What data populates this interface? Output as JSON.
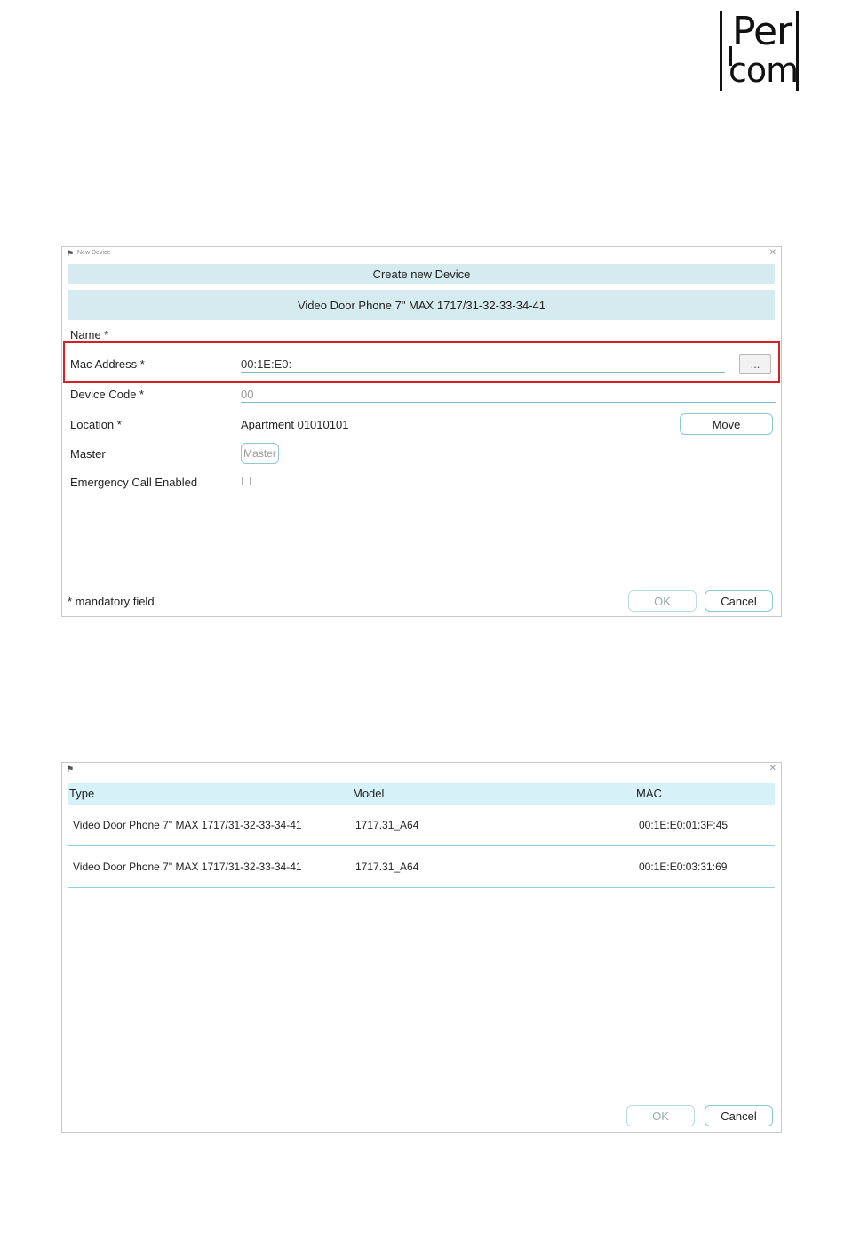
{
  "logo": {
    "line1": "Per",
    "line2": "com"
  },
  "dialog1": {
    "window_title": "New Device",
    "header": "Create new Device",
    "device_type": "Video Door Phone 7\" MAX 1717/31-32-33-34-41",
    "fields": {
      "name_label": "Name *",
      "mac_label": "Mac Address *",
      "mac_value": "00:1E:E0:",
      "mac_browse": "...",
      "code_label": "Device Code *",
      "code_value": "00",
      "location_label": "Location *",
      "location_value": "Apartment 01010101",
      "move_button": "Move",
      "master_label": "Master",
      "master_button": "Master",
      "emergency_label": "Emergency Call Enabled"
    },
    "footer_note": "* mandatory field",
    "ok": "OK",
    "cancel": "Cancel"
  },
  "dialog2": {
    "columns": [
      "Type",
      "Model",
      "MAC"
    ],
    "rows": [
      {
        "type": "Video Door Phone 7\" MAX 1717/31-32-33-34-41",
        "model": "1717.31_A64",
        "mac": "00:1E:E0:01:3F:45"
      },
      {
        "type": "Video Door Phone 7\" MAX 1717/31-32-33-34-41",
        "model": "1717.31_A64",
        "mac": "00:1E:E0:03:31:69"
      }
    ],
    "ok": "OK",
    "cancel": "Cancel"
  }
}
